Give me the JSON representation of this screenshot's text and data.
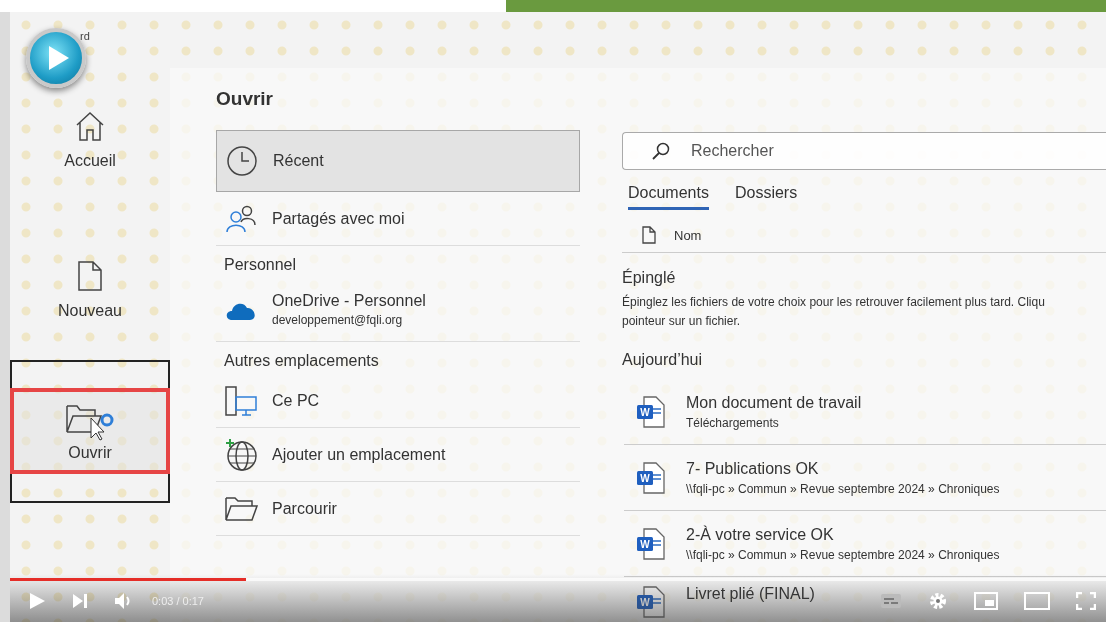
{
  "app_label": "rd",
  "sidebar": [
    {
      "label": "Accueil",
      "kind": "home",
      "selected": false
    },
    {
      "label": "Nouveau",
      "kind": "new",
      "selected": false
    },
    {
      "label": "Ouvrir",
      "kind": "open",
      "selected": true
    }
  ],
  "title": "Ouvrir",
  "locations": [
    {
      "kind": "recent",
      "label": "Récent",
      "selected": true
    },
    {
      "kind": "shared",
      "label": "Partagés avec moi",
      "selected": false
    },
    {
      "kind": "header",
      "label": "Personnel"
    },
    {
      "kind": "cloud",
      "label": "OneDrive - Personnel",
      "sub": "developpement@fqli.org",
      "selected": false
    },
    {
      "kind": "header",
      "label": "Autres emplacements"
    },
    {
      "kind": "computer",
      "label": "Ce PC",
      "selected": false
    },
    {
      "kind": "add",
      "label": "Ajouter un emplacement",
      "selected": false
    },
    {
      "kind": "browse",
      "label": "Parcourir",
      "selected": false
    }
  ],
  "search": {
    "placeholder": "Rechercher"
  },
  "tabs": [
    {
      "label": "Documents",
      "selected": true
    },
    {
      "label": "Dossiers",
      "selected": false
    }
  ],
  "column": "Nom",
  "pinned": {
    "title": "Épinglé",
    "lines": [
      "Épinglez les fichiers de votre choix pour les retrouver facilement plus tard. Cliqu",
      "pointeur sur un fichier."
    ]
  },
  "today": "Aujourd’hui",
  "files": [
    {
      "badge": "W",
      "name": "Mon document de travail",
      "path": "Téléchargements"
    },
    {
      "badge": "W",
      "name": "7- Publications OK",
      "path": "\\\\fqli-pc » Commun » Revue septembre 2024 » Chroniques"
    },
    {
      "badge": "W",
      "name": "2-À votre service OK",
      "path": "\\\\fqli-pc » Commun » Revue septembre 2024 » Chroniques"
    },
    {
      "badge": "W",
      "name": "Livret plié (FINAL)"
    }
  ],
  "player": {
    "level": 0.215,
    "time": "0:03 / 0:17"
  }
}
